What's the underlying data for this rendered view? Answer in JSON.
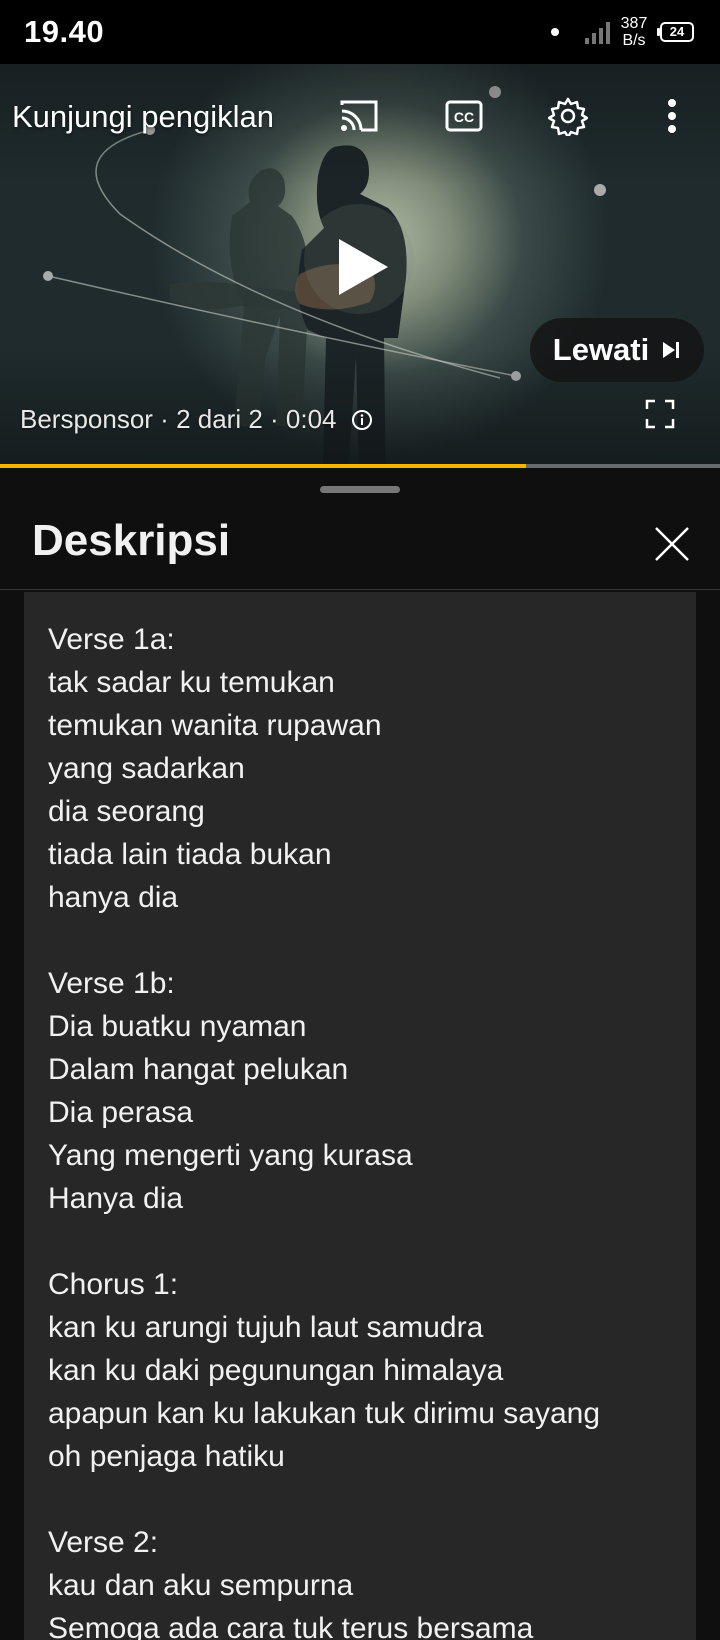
{
  "status_bar": {
    "time": "19.40",
    "net_speed_value": "387",
    "net_speed_unit": "B/s",
    "battery": "24"
  },
  "player": {
    "visit_advertiser": "Kunjungi pengiklan",
    "skip_label": "Lewati",
    "sponsor_text": "Bersponsor · 2 dari 2 · 0:04",
    "progress": 0.73,
    "icons": [
      "cast-icon",
      "captions-icon",
      "settings-gear-icon",
      "more-vert-icon",
      "play-icon",
      "skip-next-icon",
      "info-icon",
      "fullscreen-icon"
    ]
  },
  "description": {
    "title": "Deskripsi",
    "lines": [
      "Verse 1a:",
      "tak sadar ku temukan",
      "temukan wanita rupawan",
      "yang sadarkan",
      "dia seorang",
      "tiada lain tiada bukan",
      "hanya dia",
      "",
      "Verse 1b:",
      "Dia buatku nyaman",
      "Dalam hangat pelukan",
      "Dia perasa",
      "Yang mengerti yang kurasa",
      "Hanya dia",
      "",
      "Chorus 1:",
      "kan ku arungi tujuh laut samudra",
      "kan ku daki pegunungan himalaya",
      "apapun kan ku lakukan tuk dirimu sayang",
      "oh penjaga hatiku",
      "",
      "Verse 2:",
      "kau dan aku sempurna",
      "Semoga ada cara tuk terus bersama"
    ]
  },
  "colors": {
    "progress": "#f4b400",
    "sheet_bg": "#0f0f0f",
    "body_bg": "#272727"
  }
}
